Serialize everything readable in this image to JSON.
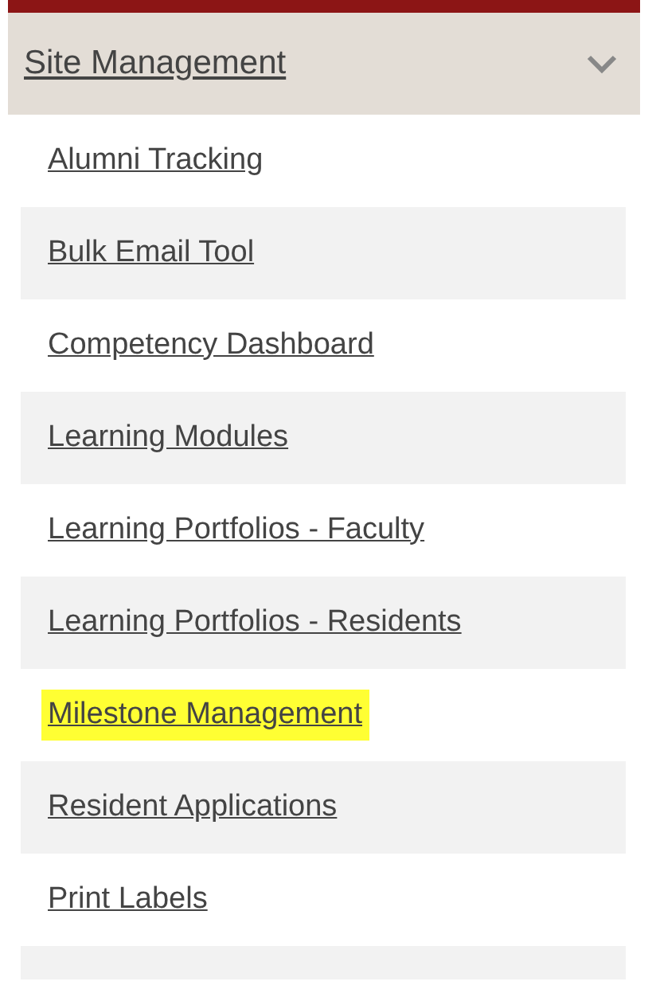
{
  "section": {
    "title": "Site Management",
    "expanded": true
  },
  "items": [
    {
      "label": "Alumni Tracking",
      "highlighted": false
    },
    {
      "label": "Bulk Email Tool",
      "highlighted": false
    },
    {
      "label": "Competency Dashboard",
      "highlighted": false
    },
    {
      "label": "Learning Modules",
      "highlighted": false
    },
    {
      "label": "Learning Portfolios - Faculty",
      "highlighted": false
    },
    {
      "label": "Learning Portfolios - Residents",
      "highlighted": false
    },
    {
      "label": "Milestone Management",
      "highlighted": true
    },
    {
      "label": "Resident Applications",
      "highlighted": false
    },
    {
      "label": "Print Labels",
      "highlighted": false
    }
  ]
}
